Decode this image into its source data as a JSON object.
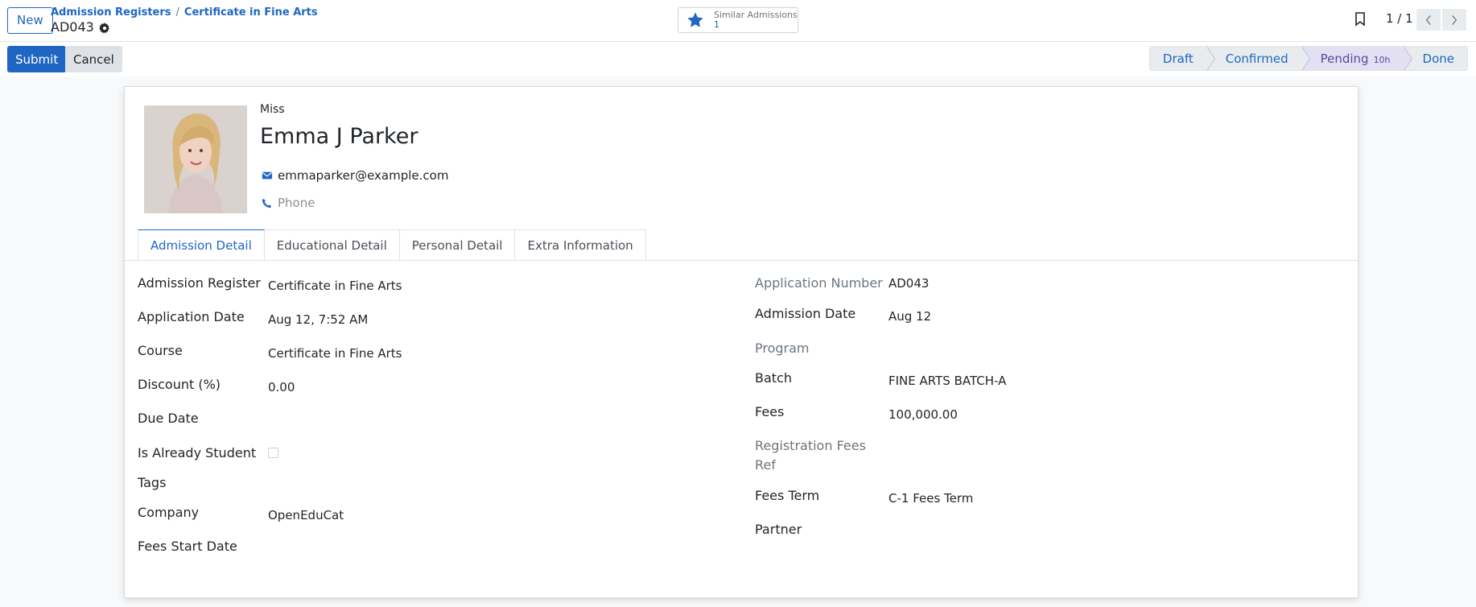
{
  "control_panel": {
    "new_label": "New",
    "breadcrumb": [
      "Admission Registers",
      "Certificate in Fine Arts"
    ],
    "breadcrumb_sep": "/",
    "record_name": "AD043",
    "smart_button": {
      "label": "Similar Admissions",
      "value": "1"
    },
    "pager": "1 / 1"
  },
  "actions": {
    "submit": "Submit",
    "cancel": "Cancel"
  },
  "statusbar": [
    {
      "label": "Draft"
    },
    {
      "label": "Confirmed"
    },
    {
      "label": "Pending",
      "badge": "10h",
      "active": true
    },
    {
      "label": "Done"
    }
  ],
  "header": {
    "title": "Miss",
    "name": "Emma J Parker",
    "email": "emmaparker@example.com",
    "phone_placeholder": "Phone"
  },
  "tabs": [
    "Admission Detail",
    "Educational Detail",
    "Personal Detail",
    "Extra Information"
  ],
  "left_fields": [
    {
      "label": "Admission Register",
      "value": "Certificate in Fine Arts"
    },
    {
      "label": "Application Date",
      "value": "Aug 12, 7:52 AM"
    },
    {
      "label": "Course",
      "value": "Certificate in Fine Arts"
    },
    {
      "label": "Discount (%)",
      "value": "0.00"
    },
    {
      "label": "Due Date",
      "value": ""
    },
    {
      "label": "Is Already Student",
      "value": ""
    },
    {
      "label": "Tags",
      "value": ""
    },
    {
      "label": "Company",
      "value": "OpenEduCat"
    },
    {
      "label": "Fees Start Date",
      "value": ""
    }
  ],
  "right_fields": [
    {
      "label": "Application Number",
      "value": "AD043"
    },
    {
      "label": "Admission Date",
      "value": "Aug 12"
    },
    {
      "label": "Program",
      "value": ""
    },
    {
      "label": "Batch",
      "value": "FINE ARTS BATCH-A"
    },
    {
      "label": "Fees",
      "value": "100,000.00"
    },
    {
      "label": "Registration Fees",
      "label2": "Ref",
      "value": ""
    },
    {
      "label": "Fees Term",
      "value": "C-1 Fees Term"
    },
    {
      "label": "Partner",
      "value": ""
    }
  ],
  "colors": {
    "accent": "#1f66c2",
    "active_stage": "#e3e0f4"
  },
  "icons": [
    "gear-icon",
    "star-icon",
    "bookmark-icon",
    "envelope-icon",
    "phone-icon",
    "chevron-left-icon",
    "chevron-right-icon"
  ]
}
